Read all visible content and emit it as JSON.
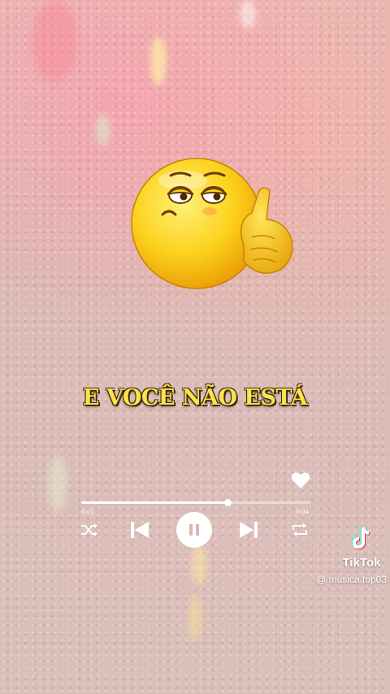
{
  "lyric": "E VOCÊ NÃO ESTÁ",
  "player": {
    "progress": 0.64,
    "time_elapsed": "0:01",
    "time_total": "0:04",
    "controls": [
      "shuffle-icon",
      "previous-icon",
      "pause-icon",
      "next-icon",
      "repeat-icon"
    ],
    "liked_icon": "heart-icon"
  },
  "emoji_icon": "bored-face-pointing-emoji",
  "watermark": {
    "brand": "TikTok",
    "handle": "@ musica.top03"
  },
  "colors": {
    "lyric_fill": "#fde24a",
    "lyric_outline": "#3a2a10",
    "controls": "#ffffff"
  }
}
